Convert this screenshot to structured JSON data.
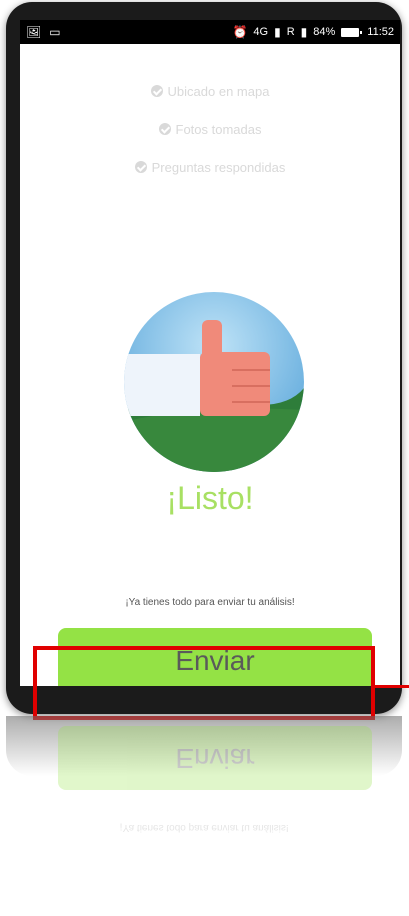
{
  "status_bar": {
    "signal_label": "4G",
    "carrier_label": "R",
    "battery_percent": "84%",
    "time": "11:52"
  },
  "checklist": [
    {
      "label": "Ubicado en mapa",
      "icon": "check-circle-icon",
      "done": true
    },
    {
      "label": "Fotos tomadas",
      "icon": "check-circle-icon",
      "done": true
    },
    {
      "label": "Preguntas respondidas",
      "icon": "check-circle-icon",
      "done": true
    }
  ],
  "main": {
    "title": "¡Listo!",
    "subtitle": "¡Ya tienes todo para enviar tu análisis!",
    "send_label": "Enviar"
  },
  "colors": {
    "accent_green": "#94e245",
    "title_green": "#a8e063",
    "highlight_red": "#e00000",
    "sky_blue": "#6ab0e0",
    "hill_green": "#2e7d3a",
    "hand_pink": "#f08a7a",
    "sleeve_white": "#eef4fb"
  }
}
